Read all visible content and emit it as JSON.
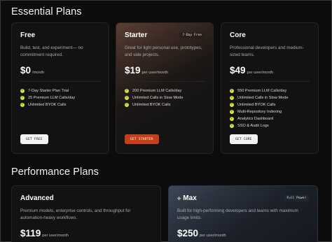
{
  "sections": {
    "essential_title": "Essential Plans",
    "performance_title": "Performance Plans"
  },
  "colors": {
    "background": "#0c0c0c",
    "check": "#d4e23a",
    "accent_button": "#c4401c"
  },
  "essential": [
    {
      "name": "Free",
      "badge": "",
      "description": "Build, test, and experiment— no commitment required.",
      "price": "$0",
      "period": "/month",
      "features": [
        "7-Day Starter Plan Trial",
        "25 Premium LLM Calls/day",
        "Unlimited BYOK Calls"
      ],
      "button": "GET FREE"
    },
    {
      "name": "Starter",
      "badge": "7-Day Free",
      "description": "Great for light personal use, prototypes, and side projects.",
      "price": "$19",
      "period": "per user/month",
      "features": [
        "200 Premium LLM Calls/day",
        "Unlimited Calls in Slow Mode",
        "Unlimited BYOK Calls"
      ],
      "button": "GET STARTER"
    },
    {
      "name": "Core",
      "badge": "",
      "description": "Professional developers and medium-sized teams.",
      "price": "$49",
      "period": "per user/month",
      "features": [
        "550 Premium LLM Calls/day",
        "Unlimited Calls in Slow Mode",
        "Unlimited BYOK Calls",
        "Multi-Repository Indexing",
        "Analytics Dashboard",
        "SSO & Audit Logs"
      ],
      "button": "GET CORE"
    }
  ],
  "performance": [
    {
      "name": "Advanced",
      "badge": "",
      "description": "Premium models, enterprise controls, and throughput for automation-heavy workflows.",
      "price": "$119",
      "period": "per user/month"
    },
    {
      "name": "Max",
      "icon": "sparkle-icon",
      "badge": "Full Power",
      "description": "Built for high-performing developers and teams with maximum usage limits.",
      "price": "$250",
      "period": "per user/month"
    }
  ]
}
